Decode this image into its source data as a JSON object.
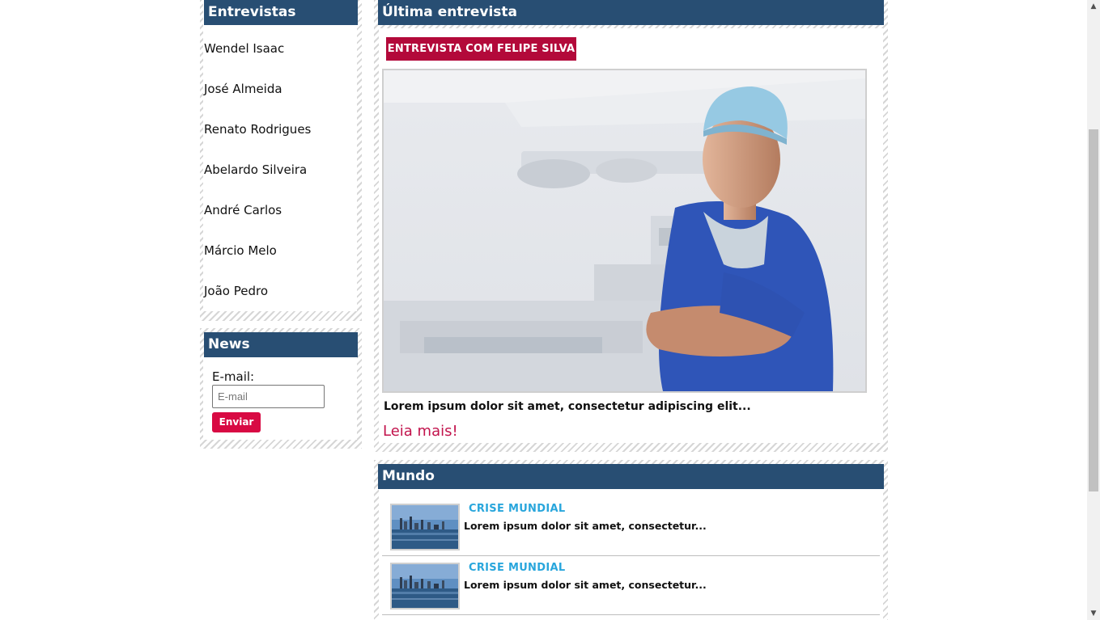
{
  "sidebar": {
    "entrevistas": {
      "title": "Entrevistas",
      "items": [
        {
          "label": "Wendel Isaac"
        },
        {
          "label": "José Almeida"
        },
        {
          "label": "Renato Rodrigues"
        },
        {
          "label": "Abelardo Silveira"
        },
        {
          "label": "André Carlos"
        },
        {
          "label": "Márcio Melo"
        },
        {
          "label": "João Pedro"
        }
      ]
    },
    "news": {
      "title": "News",
      "email_label": "E-mail:",
      "email_placeholder": "E-mail",
      "email_value": "",
      "submit_label": "Enviar"
    }
  },
  "main": {
    "ultima": {
      "title": "Última entrevista",
      "badge": "ENTREVISTA COM FELIPE SILVA",
      "excerpt": "Lorem ipsum dolor sit amet, consectetur adipiscing elit...",
      "read_more": "Leia mais!"
    },
    "mundo": {
      "title": "Mundo",
      "items": [
        {
          "title": "CRISE MUNDIAL",
          "text": "Lorem ipsum dolor sit amet, consectetur..."
        },
        {
          "title": "CRISE MUNDIAL",
          "text": "Lorem ipsum dolor sit amet, consectetur..."
        }
      ]
    }
  },
  "colors": {
    "header": "#284e73",
    "badge": "#b3093a",
    "button": "#d80a43",
    "link": "#c2134c",
    "news_title": "#29a6dc"
  }
}
